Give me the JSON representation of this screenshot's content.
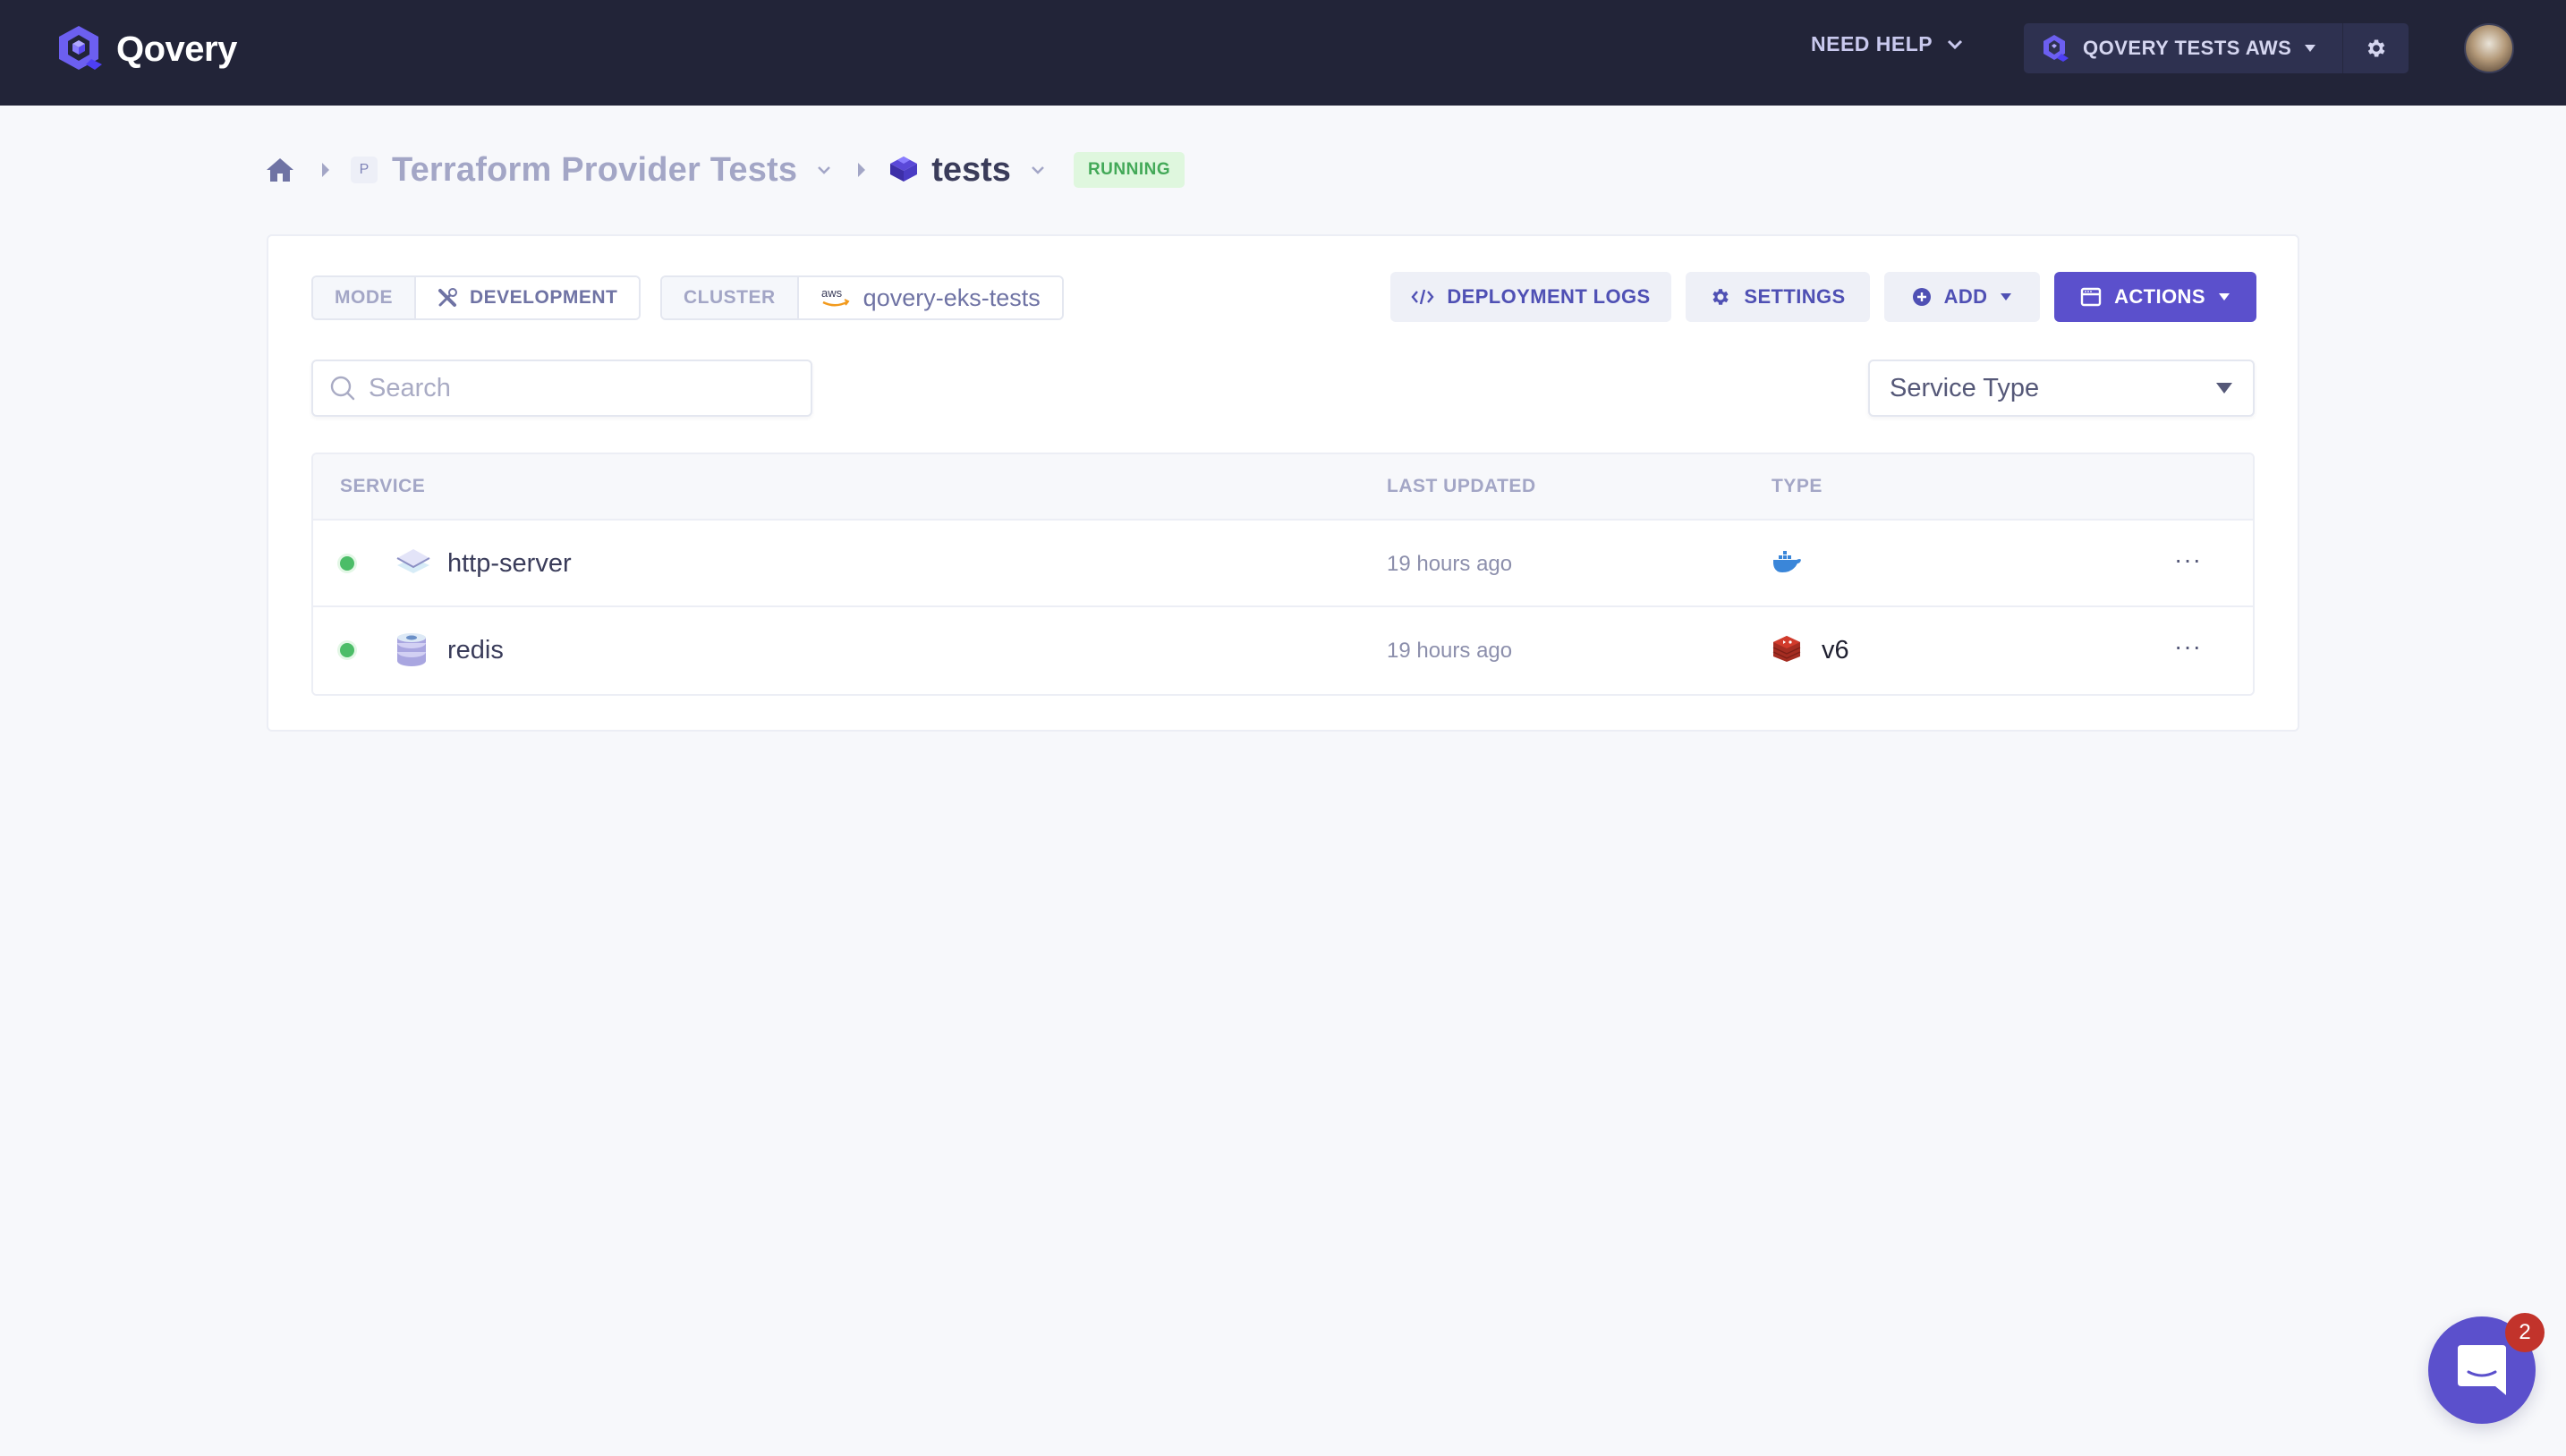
{
  "topbar": {
    "brand": "Qovery",
    "need_help": "NEED HELP",
    "organization": "QOVERY TESTS AWS"
  },
  "breadcrumb": {
    "project_badge": "P",
    "project": "Terraform Provider Tests",
    "environment": "tests",
    "status": "RUNNING"
  },
  "env_info": {
    "mode_label": "MODE",
    "mode_value": "DEVELOPMENT",
    "cluster_label": "CLUSTER",
    "cluster_provider": "aws",
    "cluster_value": "qovery-eks-tests"
  },
  "toolbar": {
    "deployment_logs": "DEPLOYMENT LOGS",
    "settings": "SETTINGS",
    "add": "ADD",
    "actions": "ACTIONS"
  },
  "filters": {
    "search_placeholder": "Search",
    "search_value": "",
    "service_type": "Service Type"
  },
  "table": {
    "columns": [
      "SERVICE",
      "LAST UPDATED",
      "TYPE"
    ],
    "rows": [
      {
        "status": "running",
        "icon": "application-icon",
        "name": "http-server",
        "last_updated": "19 hours ago",
        "type_icon": "docker-icon",
        "version": ""
      },
      {
        "status": "running",
        "icon": "database-icon",
        "name": "redis",
        "last_updated": "19 hours ago",
        "type_icon": "redis-icon",
        "version": "v6"
      }
    ],
    "row_menu": "···"
  },
  "chat": {
    "unread_count": "2"
  },
  "colors": {
    "nav_bg": "#222438",
    "brand_primary": "#5b50cc",
    "status_running": "#4cbd68",
    "badge_red": "#c2332b"
  }
}
